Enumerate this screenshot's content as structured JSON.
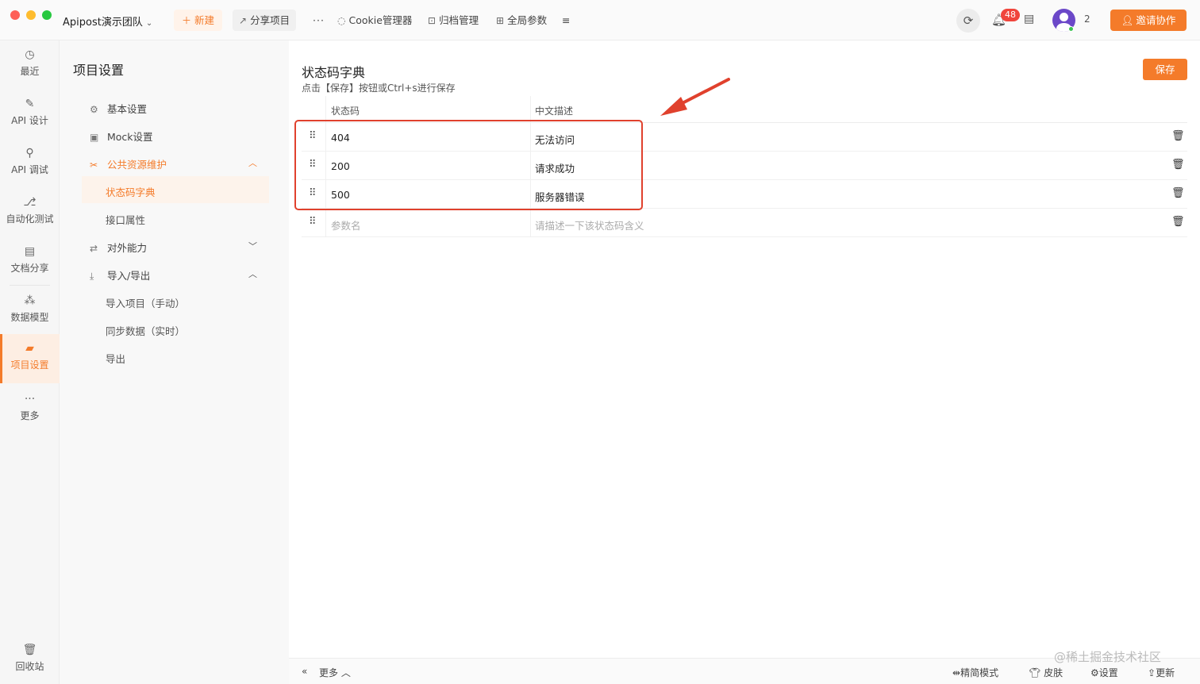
{
  "topbar": {
    "team_name": "Apipost演示团队",
    "new_label": "新建",
    "share_label": "分享项目",
    "more_label": "···",
    "cookie_label": "Cookie管理器",
    "archive_label": "归档管理",
    "global_params_label": "全局参数",
    "notification_count": "48",
    "member_count": "2",
    "invite_label": "邀请协作"
  },
  "rail": {
    "items": [
      {
        "label": "最近",
        "icon": "clock-icon"
      },
      {
        "label": "API 设计",
        "icon": "edit-icon"
      },
      {
        "label": "API 调试",
        "icon": "rocket-icon"
      },
      {
        "label": "自动化测试",
        "icon": "flow-icon"
      },
      {
        "label": "文档分享",
        "icon": "doc-share-icon"
      },
      {
        "label": "数据模型",
        "icon": "model-icon"
      },
      {
        "label": "项目设置",
        "icon": "folder-gear-icon"
      },
      {
        "label": "更多",
        "icon": "more-icon"
      }
    ],
    "trash_label": "回收站"
  },
  "menu": {
    "title": "项目设置",
    "basic": "基本设置",
    "mock": "Mock设置",
    "public_resources": "公共资源维护",
    "status_dict": "状态码字典",
    "interface_attrs": "接口属性",
    "external": "对外能力",
    "import_export": "导入/导出",
    "import_manual": "导入项目（手动）",
    "sync_data": "同步数据（实时）",
    "export": "导出"
  },
  "main": {
    "title": "状态码字典",
    "hint": "点击【保存】按钮或Ctrl+s进行保存",
    "save_label": "保存",
    "col_code": "状态码",
    "col_desc": "中文描述",
    "rows": [
      {
        "code": "404",
        "desc": "无法访问"
      },
      {
        "code": "200",
        "desc": "请求成功"
      },
      {
        "code": "500",
        "desc": "服务器错误"
      }
    ],
    "placeholder_code": "参数名",
    "placeholder_desc": "请描述一下该状态码含义"
  },
  "bottombar": {
    "more_label": "更多",
    "compact_label": "精简模式",
    "skin_label": "皮肤",
    "settings_label": "设置",
    "update_label": "更新",
    "watermark": "@稀土掘金技术社区"
  },
  "colors": {
    "accent": "#f47b2a",
    "annotation": "#e0412d"
  }
}
